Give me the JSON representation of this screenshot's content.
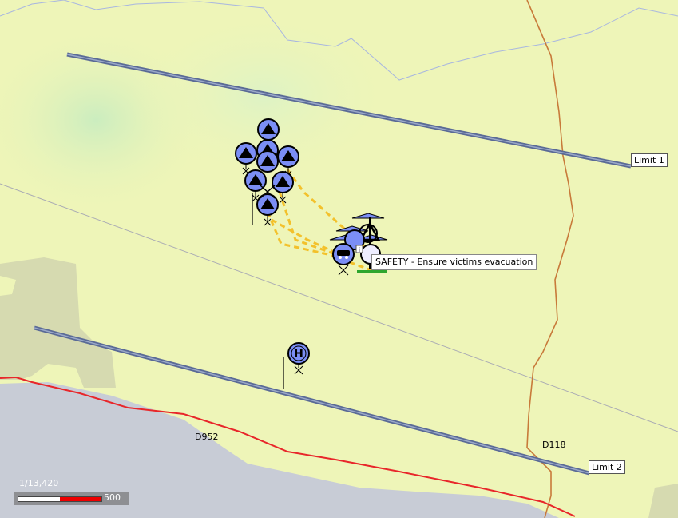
{
  "map": {
    "roads": {
      "road_d952": "D952",
      "road_d118": "D118"
    },
    "limits": {
      "limit_1": "Limit 1",
      "limit_2": "Limit 2"
    },
    "safety_label": "SAFETY - Ensure victims evacuation",
    "scale": {
      "ratio": "1/13,420",
      "distance": "500"
    },
    "icons": {
      "unit_symbol": "triangle-unit-icon",
      "helicopter": "helicopter-icon",
      "info": "info-icon"
    },
    "colors": {
      "land": "#eef5b8",
      "water": "#c8ccd6",
      "built_area": "#d6dab0",
      "road_red": "#e8262a",
      "road_brown": "#c87a3a",
      "limit_line": "#5a6a96",
      "unit_fill": "#7b8ef5",
      "link_dashed": "#f3c12b"
    }
  }
}
